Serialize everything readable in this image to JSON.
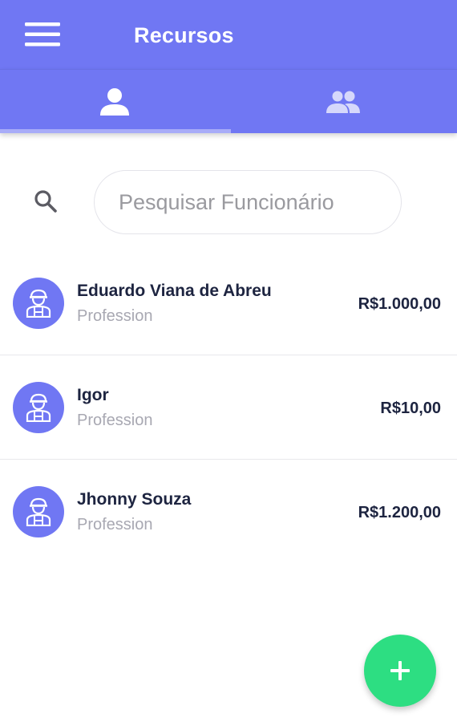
{
  "app": {
    "title": "Recursos",
    "accent_color": "#7077f3",
    "fab_color": "#2dde82"
  },
  "header": {
    "menu_icon": "hamburger-menu-icon"
  },
  "tabs": [
    {
      "icon": "person-icon",
      "active": true
    },
    {
      "icon": "group-icon",
      "active": false
    }
  ],
  "search": {
    "placeholder": "Pesquisar Funcionário",
    "value": "",
    "icon": "search-icon"
  },
  "employees": [
    {
      "name": "Eduardo Viana de Abreu",
      "profession": "Profession",
      "value": "R$1.000,00",
      "avatar_icon": "worker-icon"
    },
    {
      "name": "Igor",
      "profession": "Profession",
      "value": "R$10,00",
      "avatar_icon": "worker-icon"
    },
    {
      "name": "Jhonny Souza",
      "profession": "Profession",
      "value": "R$1.200,00",
      "avatar_icon": "worker-icon"
    }
  ],
  "fab": {
    "icon": "plus-icon"
  }
}
